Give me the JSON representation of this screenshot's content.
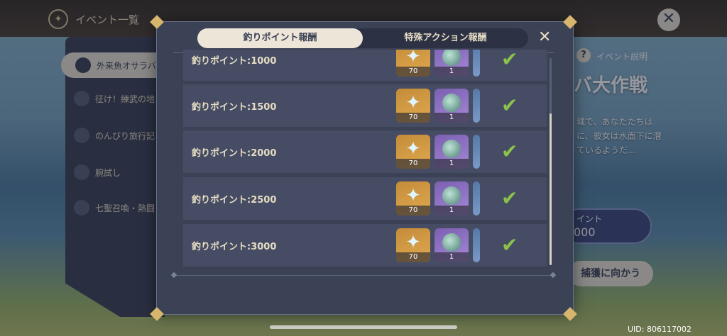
{
  "background": {
    "title": "イベント一覧",
    "sidebar": [
      {
        "label": "外来魚オサラバ",
        "active": true
      },
      {
        "label": "征け！練武の地",
        "active": false
      },
      {
        "label": "のんびり旅行記・集章",
        "active": false
      },
      {
        "label": "腕試し",
        "active": false
      },
      {
        "label": "七聖召喚・熱闘",
        "active": false
      }
    ],
    "event_info_label": "イベント説明",
    "event_title": "バ大作戦",
    "description": "域で、あなたたちは に、彼女は水面下に潜 ているようだ…",
    "points_label": "イント",
    "points_value": "000",
    "go_button": "捕獲に向かう",
    "uid": "UID: 806117002"
  },
  "modal": {
    "tabs": [
      {
        "label": "釣りポイント報酬",
        "active": true
      },
      {
        "label": "特殊アクション報酬",
        "active": false
      }
    ],
    "close_icon": "close-x-icon",
    "rows": [
      {
        "label": "釣りポイント:1000",
        "rewards": [
          {
            "type": "primogem",
            "count": "70"
          },
          {
            "type": "fish-bait",
            "count": "1"
          },
          {
            "type": "partial",
            "count": ""
          }
        ],
        "claimed": true
      },
      {
        "label": "釣りポイント:1500",
        "rewards": [
          {
            "type": "primogem",
            "count": "70"
          },
          {
            "type": "fish-bait",
            "count": "1"
          },
          {
            "type": "partial",
            "count": ""
          }
        ],
        "claimed": true
      },
      {
        "label": "釣りポイント:2000",
        "rewards": [
          {
            "type": "primogem",
            "count": "70"
          },
          {
            "type": "fish-bait",
            "count": "1"
          },
          {
            "type": "partial",
            "count": ""
          }
        ],
        "claimed": true
      },
      {
        "label": "釣りポイント:2500",
        "rewards": [
          {
            "type": "primogem",
            "count": "70"
          },
          {
            "type": "fish-bait",
            "count": "1"
          },
          {
            "type": "partial",
            "count": ""
          }
        ],
        "claimed": true
      },
      {
        "label": "釣りポイント:3000",
        "rewards": [
          {
            "type": "primogem",
            "count": "70"
          },
          {
            "type": "fish-bait",
            "count": "1"
          },
          {
            "type": "partial",
            "count": ""
          }
        ],
        "claimed": true
      }
    ],
    "check_icon": "checkmark-icon",
    "scroll_position": 0.27
  }
}
